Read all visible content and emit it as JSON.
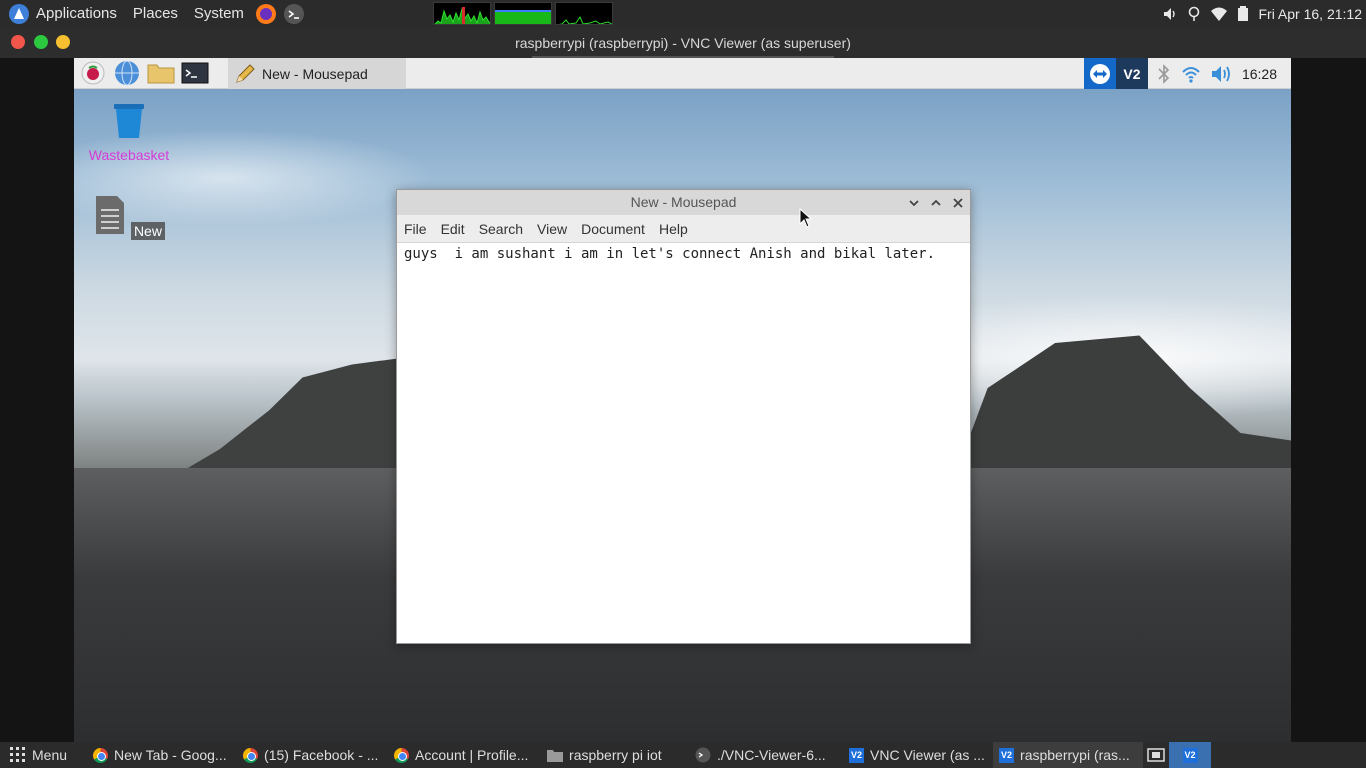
{
  "host_panel": {
    "menus": [
      "Applications",
      "Places",
      "System"
    ],
    "clock": "Fri Apr 16, 21:12"
  },
  "vnc_window": {
    "title": "raspberrypi (raspberrypi) - VNC Viewer (as superuser)"
  },
  "pi_panel": {
    "task_label": "New - Mousepad",
    "clock": "16:28"
  },
  "desktop": {
    "icons": [
      {
        "label": "Wastebasket"
      },
      {
        "label": "New"
      }
    ]
  },
  "mousepad": {
    "title": "New - Mousepad",
    "menu": [
      "File",
      "Edit",
      "Search",
      "View",
      "Document",
      "Help"
    ],
    "content": "guys  i am sushant i am in let's connect Anish and bikal later."
  },
  "taskbar": {
    "menu_label": "Menu",
    "items": [
      {
        "label": "New Tab - Goog..."
      },
      {
        "label": "(15) Facebook - ..."
      },
      {
        "label": "Account | Profile..."
      },
      {
        "label": "raspberry pi iot"
      },
      {
        "label": "./VNC-Viewer-6..."
      },
      {
        "label": "VNC Viewer (as ..."
      },
      {
        "label": "raspberrypi (ras..."
      }
    ]
  },
  "colors": {
    "folder": "#e8c46a",
    "wastebasket": "#1e88d6",
    "wastebasket_label": "#d63bd6",
    "vnc_blue": "#1e6fd9"
  }
}
